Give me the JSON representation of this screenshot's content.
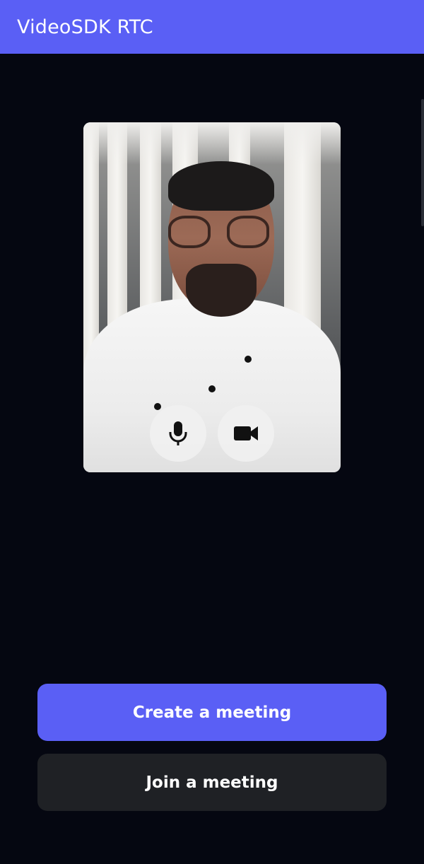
{
  "app_bar": {
    "title": "VideoSDK RTC",
    "color": "#5A5FF5"
  },
  "preview": {
    "mic_button_icon": "mic-icon",
    "camera_button_icon": "videocam-icon"
  },
  "actions": {
    "create_label": "Create a meeting",
    "join_label": "Join a meeting"
  },
  "colors": {
    "background": "#050711",
    "primary": "#5A5FF5",
    "secondary": "#1f2125"
  }
}
